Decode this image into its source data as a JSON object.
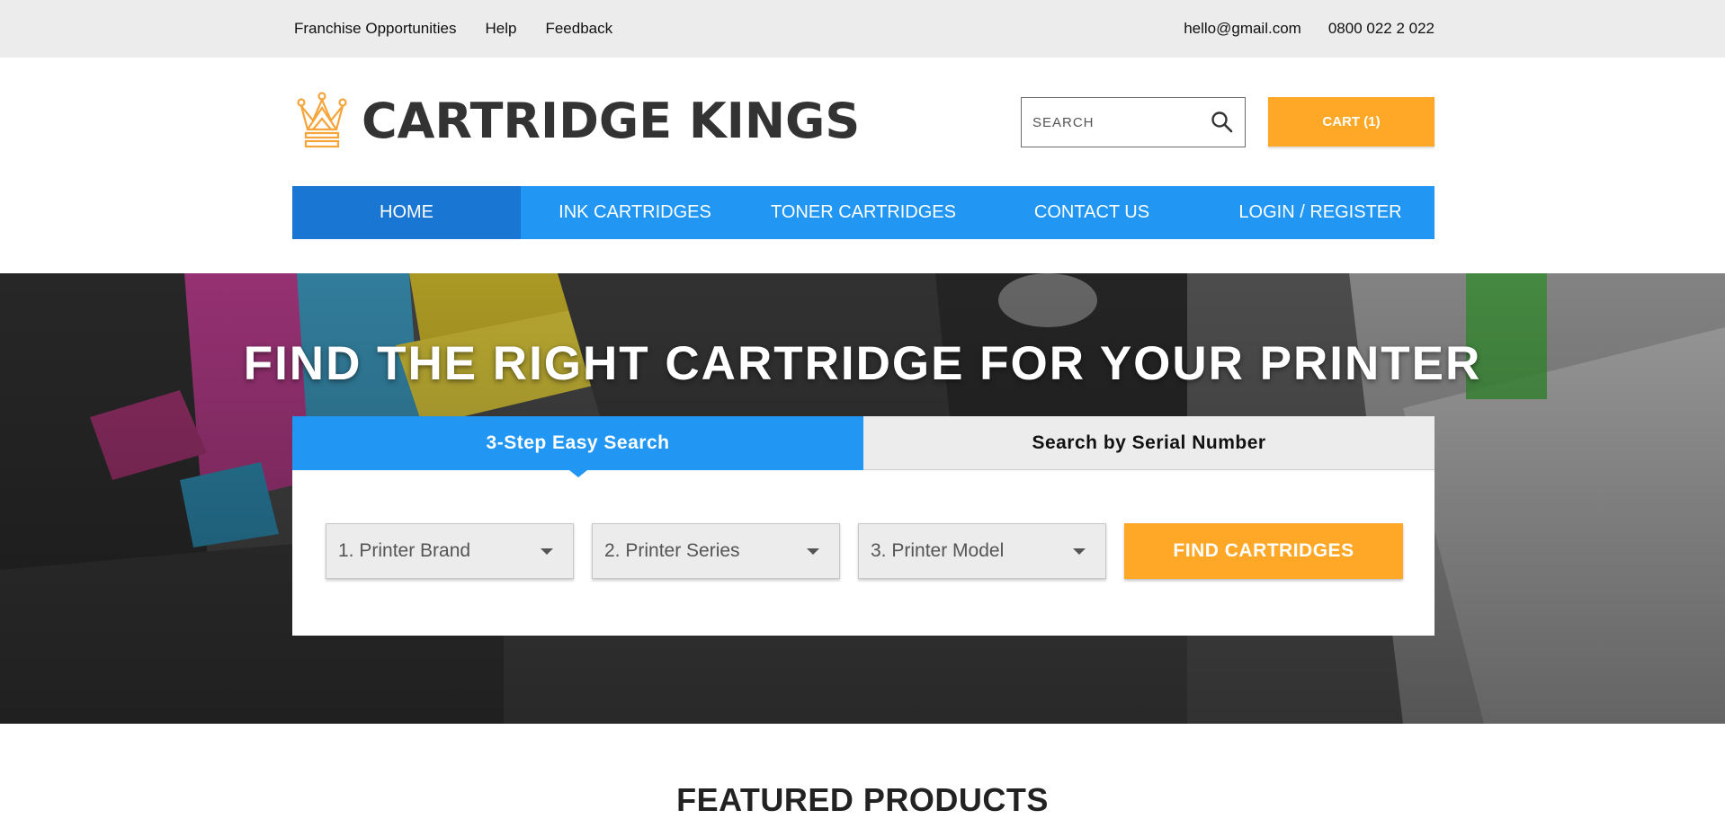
{
  "topbar": {
    "links": [
      "Franchise Opportunities",
      "Help",
      "Feedback"
    ],
    "email": "hello@gmail.com",
    "phone": "0800 022 2 022"
  },
  "header": {
    "logo_text": "CARTRIDGE KINGS",
    "logo_icon": "crown-icon",
    "search_placeholder": "SEARCH",
    "search_icon": "search-icon",
    "cart_label": "CART (1)"
  },
  "nav": {
    "items": [
      "HOME",
      "INK CARTRIDGES",
      "TONER CARTRIDGES",
      "CONTACT US",
      "LOGIN / REGISTER"
    ],
    "active": "HOME"
  },
  "hero": {
    "title": "FIND THE RIGHT CARTRIDGE FOR YOUR PRINTER",
    "tabs": [
      "3-Step Easy Search",
      "Search by Serial Number"
    ],
    "active_tab": "3-Step Easy Search",
    "selects": [
      "1. Printer Brand",
      "2. Printer Series",
      "3. Printer Model"
    ],
    "find_button": "FIND CARTRIDGES"
  },
  "featured": {
    "title": "FEATURED PRODUCTS"
  },
  "colors": {
    "primary_blue": "#2196f3",
    "active_blue": "#1976d2",
    "accent_orange": "#ffa726",
    "topbar_bg": "#ececec"
  }
}
